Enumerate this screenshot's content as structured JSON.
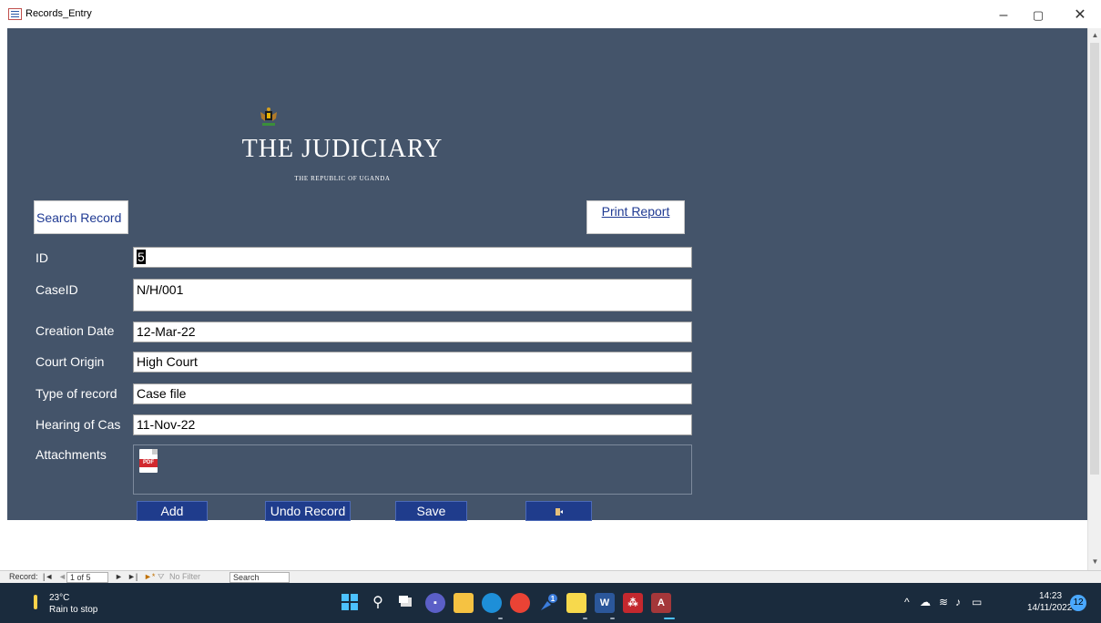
{
  "window": {
    "title": "Records_Entry",
    "minimize": "–",
    "maximize": "▢",
    "close": "✕"
  },
  "logo": {
    "title": "THE JUDICIARY",
    "subtitle": "THE REPUBLIC OF UGANDA"
  },
  "buttons": {
    "search_record": "Search Record",
    "print_report": "Print Report",
    "add": "Add",
    "undo_record": "Undo Record",
    "save": "Save"
  },
  "fields": {
    "id": {
      "label": "ID",
      "value": "5"
    },
    "case_id": {
      "label": "CaseID",
      "value": "N/H/001"
    },
    "creation_date": {
      "label": "Creation Date",
      "value": "12-Mar-22"
    },
    "court_origin": {
      "label": "Court Origin",
      "value": "High Court"
    },
    "type_of_record": {
      "label": "Type of record",
      "value": "Case file"
    },
    "hearing_of_case": {
      "label": "Hearing of Cas",
      "value": "11-Nov-22"
    },
    "attachments": {
      "label": "Attachments",
      "file_icon": "pdf-file-icon",
      "file_icon_text": "PDF"
    }
  },
  "status_bar": {
    "record_label": "Record:",
    "first": "|◄",
    "prev": "◄",
    "position": "1 of 5",
    "next": "►",
    "last": "►|",
    "new": "►*",
    "filter": "No Filter",
    "search": "Search"
  },
  "taskbar": {
    "weather_temp": "23°C",
    "weather_desc": "Rain to stop",
    "time": "14:23",
    "date": "14/11/2022",
    "notifications": "12"
  },
  "colors": {
    "form_bg": "#44546a",
    "button_bg": "#1f3c8c",
    "link_text": "#1f3a93"
  }
}
